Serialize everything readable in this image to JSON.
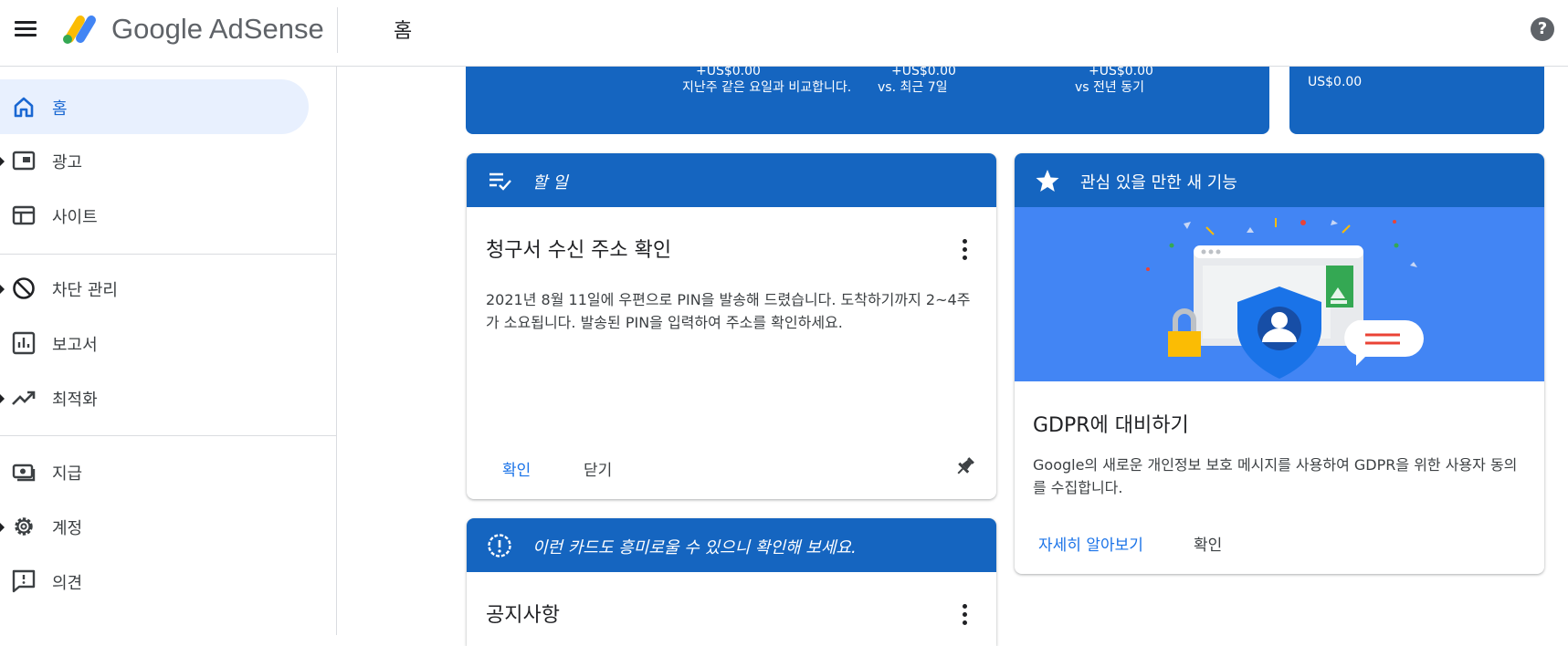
{
  "app": {
    "logo_text": "Google AdSense",
    "page_title": "홈",
    "help_icon": "help-circle-icon"
  },
  "sidebar": {
    "items": [
      {
        "label": "홈",
        "icon": "home-icon",
        "active": true
      },
      {
        "label": "광고",
        "icon": "ads-icon"
      },
      {
        "label": "사이트",
        "icon": "sites-icon"
      },
      {
        "label": "차단 관리",
        "icon": "block-icon"
      },
      {
        "label": "보고서",
        "icon": "reports-icon"
      },
      {
        "label": "최적화",
        "icon": "trending-up-icon"
      },
      {
        "label": "지급",
        "icon": "payments-icon"
      },
      {
        "label": "계정",
        "icon": "gear-icon"
      },
      {
        "label": "의견",
        "icon": "feedback-icon"
      }
    ]
  },
  "earnings": {
    "stats": [
      {
        "value": "+US$0.00",
        "caption": "지난주 같은 요일과 비교합니다."
      },
      {
        "value": "+US$0.00",
        "caption": "vs. 최근 7일"
      },
      {
        "value": "+US$0.00",
        "caption": "vs 전년 동기"
      }
    ],
    "side": {
      "label": "",
      "value": "US$0.00"
    }
  },
  "todo_card": {
    "header": "할 일",
    "title": "청구서 수신 주소 확인",
    "body": "2021년 8월 11일에 우편으로 PIN을 발송해 드렸습니다. 도착하기까지 2~4주가 소요됩니다. 발송된 PIN을 입력하여 주소를 확인하세요.",
    "confirm_label": "확인",
    "close_label": "닫기"
  },
  "feature_card": {
    "header": "관심 있을 만한 새 기능",
    "title": "GDPR에 대비하기",
    "body": "Google의 새로운 개인정보 보호 메시지를 사용하여 GDPR을 위한 사용자 동의를 수집합니다.",
    "learn_more_label": "자세히 알아보기",
    "confirm_label": "확인"
  },
  "suggest_card": {
    "header": "이런 카드도 흥미로울 수 있으니 확인해 보세요.",
    "title": "공지사항"
  }
}
